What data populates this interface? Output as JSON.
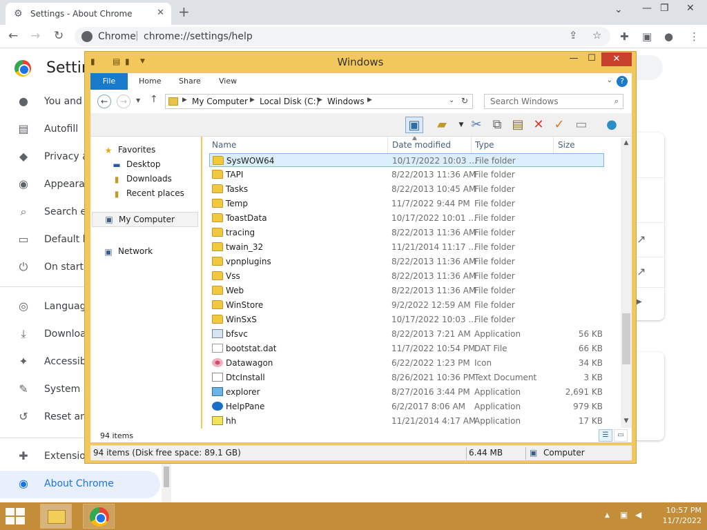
{
  "chrome": {
    "tab_title": "Settings - About Chrome",
    "site": "Chrome",
    "url": "chrome://settings/help",
    "settings_title": "Settin",
    "sidebar": [
      {
        "label": "You and G",
        "icon": "person-icon"
      },
      {
        "label": "Autofill",
        "icon": "clipboard-icon"
      },
      {
        "label": "Privacy a",
        "icon": "shield-icon"
      },
      {
        "label": "Appearan",
        "icon": "palette-icon"
      },
      {
        "label": "Search en",
        "icon": "search-icon"
      },
      {
        "label": "Default br",
        "icon": "browser-icon"
      },
      {
        "label": "On startu",
        "icon": "power-icon"
      },
      {
        "label": "Language",
        "icon": "globe-icon"
      },
      {
        "label": "Download",
        "icon": "download-icon"
      },
      {
        "label": "Accessib",
        "icon": "accessibility-icon"
      },
      {
        "label": "System",
        "icon": "wrench-icon"
      },
      {
        "label": "Reset and",
        "icon": "reset-icon"
      },
      {
        "label": "Extension",
        "icon": "puzzle-icon"
      },
      {
        "label": "About Chrome",
        "icon": "chrome-logo-icon"
      }
    ]
  },
  "explorer": {
    "window_title": "Windows",
    "ribbon_tabs": [
      "File",
      "Home",
      "Share",
      "View"
    ],
    "breadcrumb": [
      "My Computer",
      "Local Disk (C:)",
      "Windows"
    ],
    "search_placeholder": "Search Windows",
    "nav": {
      "favorites": "Favorites",
      "desktop": "Desktop",
      "downloads": "Downloads",
      "recent": "Recent places",
      "computer": "My Computer",
      "network": "Network"
    },
    "columns": {
      "name": "Name",
      "date": "Date modified",
      "type": "Type",
      "size": "Size"
    },
    "files": [
      {
        "name": "SysWOW64",
        "date": "10/17/2022 10:03 ...",
        "type": "File folder",
        "size": "",
        "icon": "folder"
      },
      {
        "name": "TAPI",
        "date": "8/22/2013 11:36 AM",
        "type": "File folder",
        "size": "",
        "icon": "folder"
      },
      {
        "name": "Tasks",
        "date": "8/22/2013 10:45 AM",
        "type": "File folder",
        "size": "",
        "icon": "folder"
      },
      {
        "name": "Temp",
        "date": "11/7/2022 9:44 PM",
        "type": "File folder",
        "size": "",
        "icon": "folder"
      },
      {
        "name": "ToastData",
        "date": "10/17/2022 10:01 ...",
        "type": "File folder",
        "size": "",
        "icon": "folder"
      },
      {
        "name": "tracing",
        "date": "8/22/2013 11:36 AM",
        "type": "File folder",
        "size": "",
        "icon": "folder"
      },
      {
        "name": "twain_32",
        "date": "11/21/2014 11:17 ...",
        "type": "File folder",
        "size": "",
        "icon": "folder"
      },
      {
        "name": "vpnplugins",
        "date": "8/22/2013 11:36 AM",
        "type": "File folder",
        "size": "",
        "icon": "folder"
      },
      {
        "name": "Vss",
        "date": "8/22/2013 11:36 AM",
        "type": "File folder",
        "size": "",
        "icon": "folder"
      },
      {
        "name": "Web",
        "date": "8/22/2013 11:36 AM",
        "type": "File folder",
        "size": "",
        "icon": "folder"
      },
      {
        "name": "WinStore",
        "date": "9/2/2022 12:59 AM",
        "type": "File folder",
        "size": "",
        "icon": "folder"
      },
      {
        "name": "WinSxS",
        "date": "10/17/2022 10:03 ...",
        "type": "File folder",
        "size": "",
        "icon": "folder"
      },
      {
        "name": "bfsvc",
        "date": "8/22/2013 7:21 AM",
        "type": "Application",
        "size": "56 KB",
        "icon": "app"
      },
      {
        "name": "bootstat.dat",
        "date": "11/7/2022 10:54 PM",
        "type": "DAT File",
        "size": "66 KB",
        "icon": "dat"
      },
      {
        "name": "Datawagon",
        "date": "6/22/2022 1:23 PM",
        "type": "Icon",
        "size": "34 KB",
        "icon": "icon"
      },
      {
        "name": "DtcInstall",
        "date": "8/26/2021 10:36 PM",
        "type": "Text Document",
        "size": "3 KB",
        "icon": "txt"
      },
      {
        "name": "explorer",
        "date": "8/27/2016 3:44 PM",
        "type": "Application",
        "size": "2,691 KB",
        "icon": "exe"
      },
      {
        "name": "HelpPane",
        "date": "6/2/2017 8:06 AM",
        "type": "Application",
        "size": "979 KB",
        "icon": "help"
      },
      {
        "name": "hh",
        "date": "11/21/2014 4:17 AM",
        "type": "Application",
        "size": "17 KB",
        "icon": "hh"
      }
    ],
    "item_count": "94 items",
    "status_left": "94 items (Disk free space: 89.1 GB)",
    "status_size": "6.44 MB",
    "status_location": "Computer"
  },
  "taskbar": {
    "time": "10:57 PM",
    "date": "11/7/2022"
  },
  "colors": {
    "explorer_frame": "#f2c75b",
    "taskbar": "#c38d3a",
    "chrome_accent": "#1a73e8"
  }
}
